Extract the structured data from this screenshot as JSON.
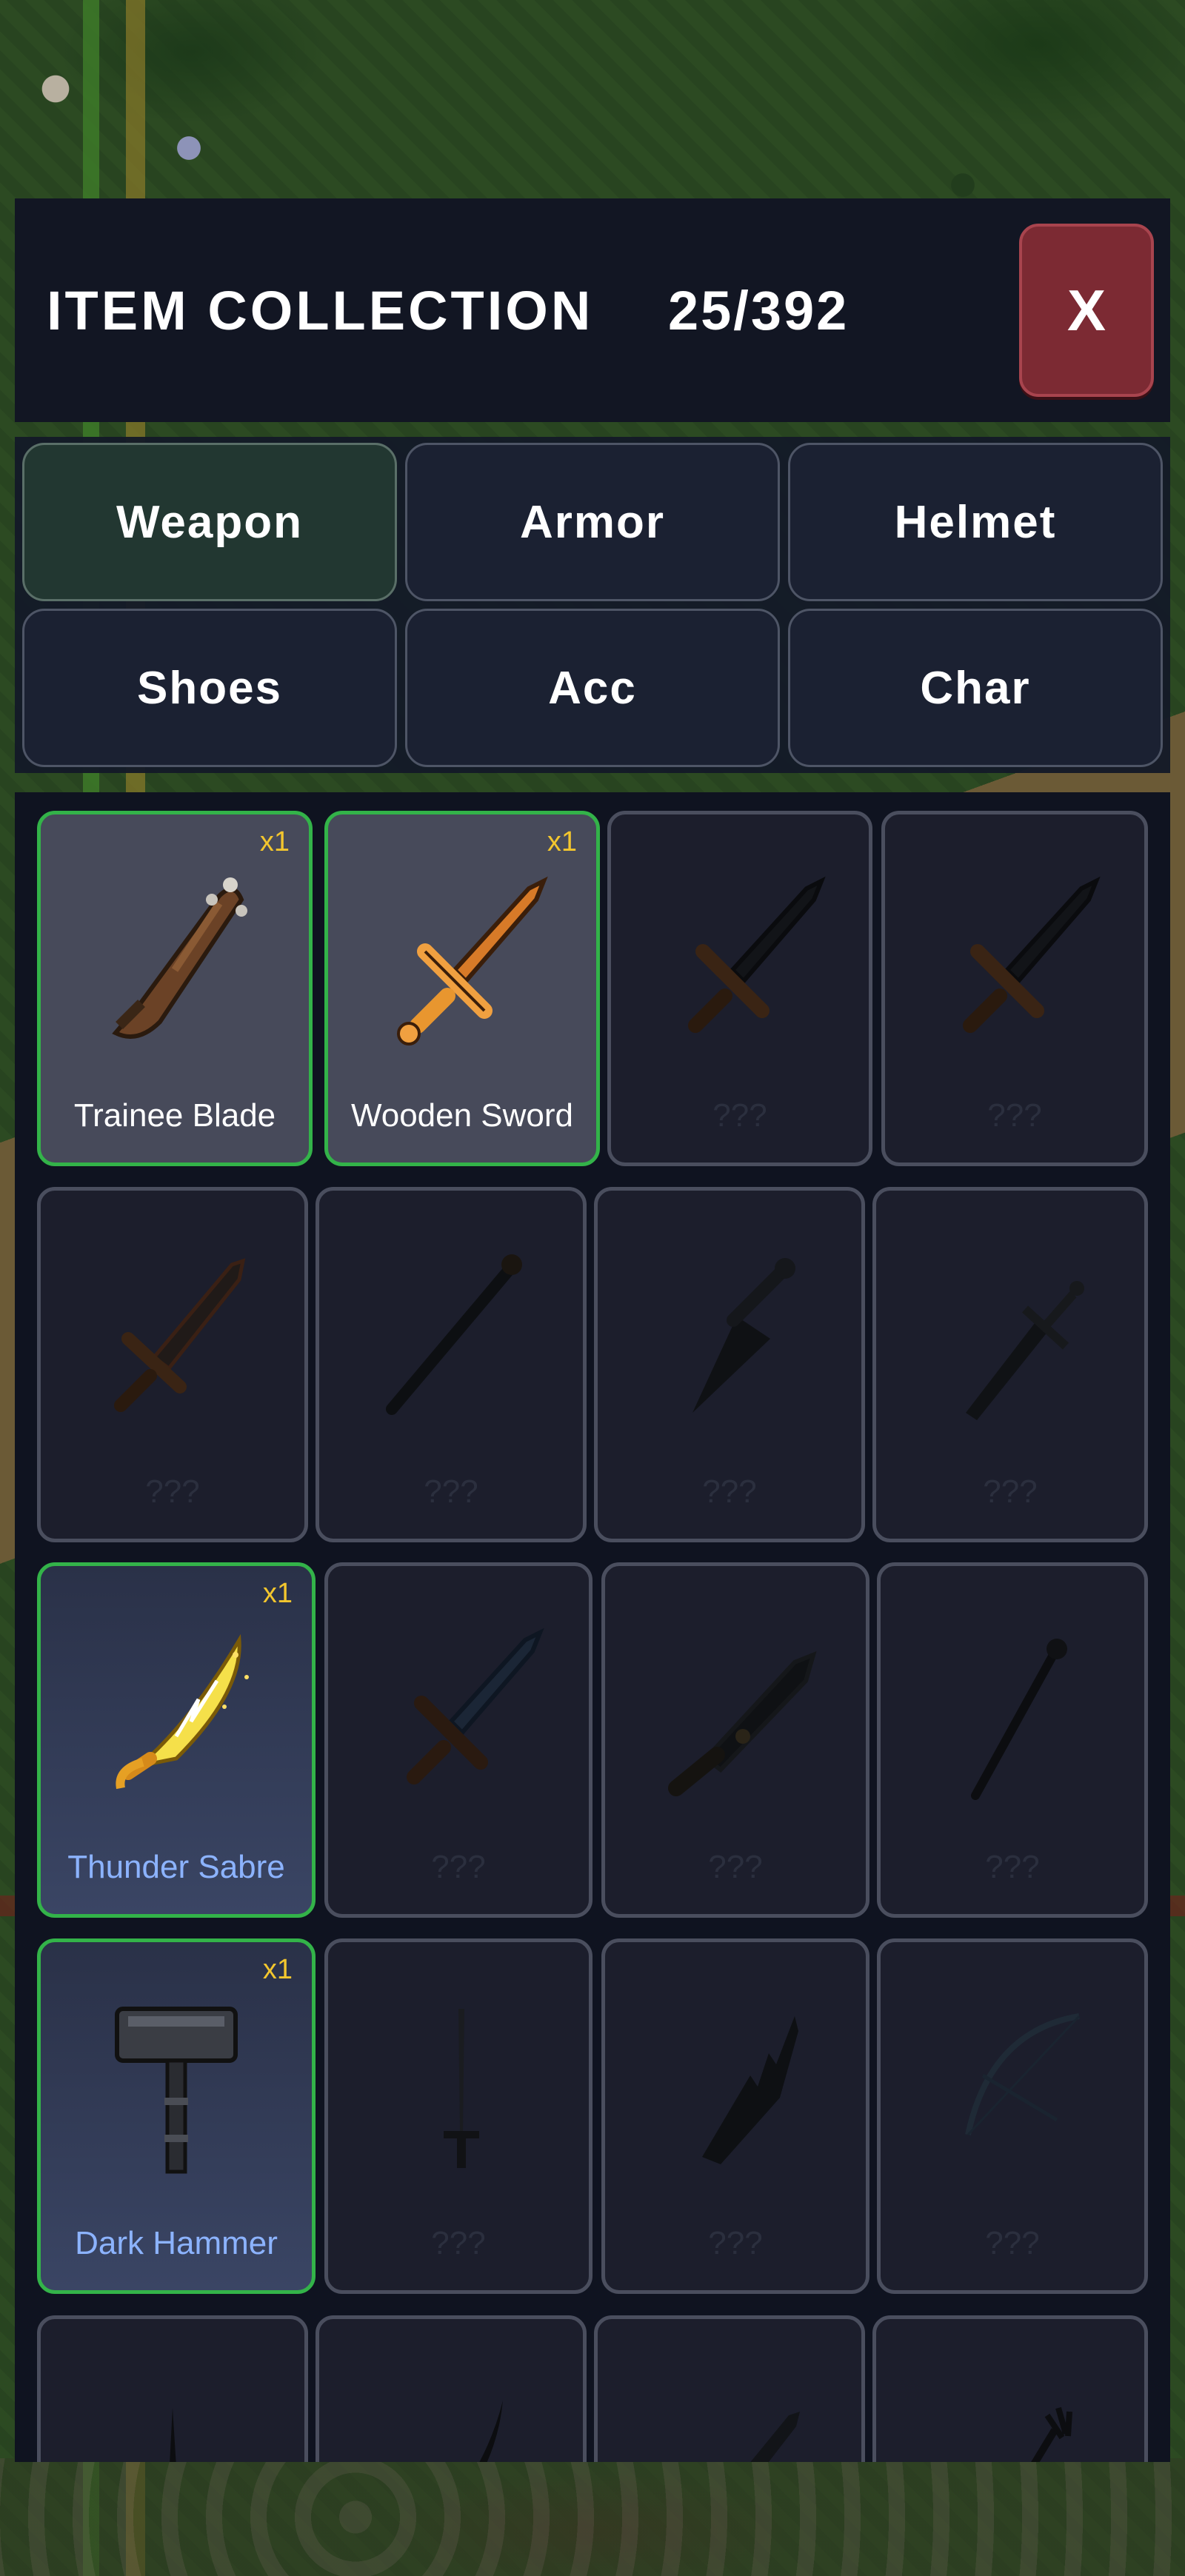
{
  "header": {
    "title": "ITEM COLLECTION",
    "count": "25/392",
    "close_label": "X"
  },
  "tabs": [
    {
      "label": "Weapon",
      "active": true
    },
    {
      "label": "Armor",
      "active": false
    },
    {
      "label": "Helmet",
      "active": false
    },
    {
      "label": "Shoes",
      "active": false
    },
    {
      "label": "Acc",
      "active": false
    },
    {
      "label": "Char",
      "active": false
    }
  ],
  "items": [
    {
      "name": "Trainee Blade",
      "qty": "x1",
      "owned": true,
      "icon": "club-icon"
    },
    {
      "name": "Wooden Sword",
      "qty": "x1",
      "owned": true,
      "icon": "wooden-sword-icon"
    },
    {
      "name": "???",
      "owned": false,
      "icon": "sword-silhouette-icon"
    },
    {
      "name": "???",
      "owned": false,
      "icon": "sword-silhouette-icon"
    },
    {
      "name": "???",
      "owned": false,
      "icon": "jagged-sword-silhouette-icon"
    },
    {
      "name": "???",
      "owned": false,
      "icon": "staff-silhouette-icon"
    },
    {
      "name": "???",
      "owned": false,
      "icon": "dagger-silhouette-icon"
    },
    {
      "name": "???",
      "owned": false,
      "icon": "shortsword-silhouette-icon"
    },
    {
      "name": "Thunder Sabre",
      "qty": "x1",
      "owned": true,
      "icon": "thunder-sabre-icon"
    },
    {
      "name": "???",
      "owned": false,
      "icon": "blue-sword-silhouette-icon"
    },
    {
      "name": "???",
      "owned": false,
      "icon": "broad-sword-silhouette-icon"
    },
    {
      "name": "???",
      "owned": false,
      "icon": "wand-silhouette-icon"
    },
    {
      "name": "Dark Hammer",
      "qty": "x1",
      "owned": true,
      "icon": "hammer-icon"
    },
    {
      "name": "???",
      "owned": false,
      "icon": "rapier-silhouette-icon"
    },
    {
      "name": "???",
      "owned": false,
      "icon": "serrated-blade-silhouette-icon"
    },
    {
      "name": "???",
      "owned": false,
      "icon": "bow-silhouette-icon"
    },
    {
      "name": "",
      "owned": false,
      "icon": "spike-silhouette-icon"
    },
    {
      "name": "",
      "owned": false,
      "icon": "scimitar-silhouette-icon"
    },
    {
      "name": "",
      "owned": false,
      "icon": "sword-silhouette-icon"
    },
    {
      "name": "",
      "owned": false,
      "icon": "trident-silhouette-icon"
    }
  ],
  "colors": {
    "owned_border": "#33b349",
    "quantity": "#f3c62e",
    "rare_name": "#8cb3ff",
    "close_button": "#7c2a33"
  }
}
